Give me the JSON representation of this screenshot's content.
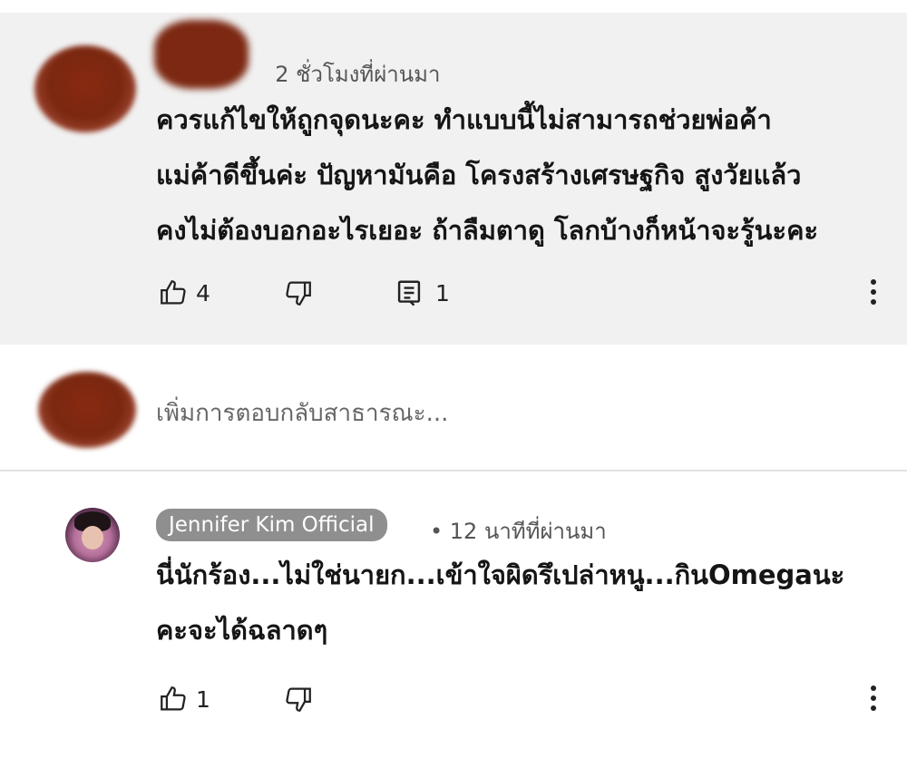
{
  "comment": {
    "time": "2 ชั่วโมงที่ผ่านมา",
    "lines": [
      "ควรแก้ไขให้ถูกจุดนะคะ ทำแบบนี้ไม่สามารถช่วยพ่อค้า",
      "แม่ค้าดีขึ้นค่ะ ปัญหามันคือ โครงสร้างเศรษฐกิจ สูงวัยแล้ว",
      "คงไม่ต้องบอกอะไรเยอะ ถ้าลืมตาดู โลกบ้างก็หน้าจะรู้นะคะ"
    ],
    "likes": "4",
    "replies": "1"
  },
  "reply_box": {
    "placeholder": "เพิ่มการตอบกลับสาธารณะ..."
  },
  "reply": {
    "author": "Jennifer Kim Official",
    "time": "• 12 นาทีที่ผ่านมา",
    "lines": [
      "นี่นักร้อง...ไม่ใช่นายก...เข้าใจผิดรึเปล่าหนู...กินOmegaนะ",
      "คะจะได้ฉลาดๆ"
    ],
    "likes": "1"
  },
  "icons": {
    "like": "thumbs-up-icon",
    "dislike": "thumbs-down-icon",
    "reply": "reply-comment-icon",
    "more": "more-vertical-icon"
  }
}
